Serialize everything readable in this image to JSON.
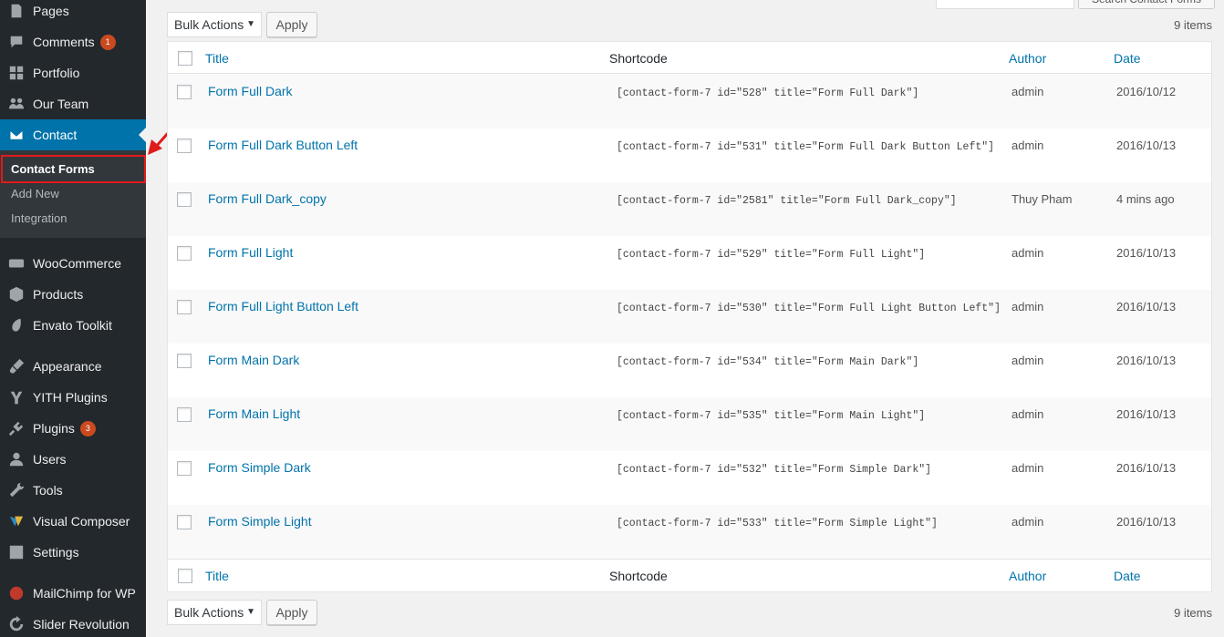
{
  "colors": {
    "sidebar_bg": "#23282d",
    "submenu_bg": "#32373c",
    "accent": "#0073aa",
    "badge": "#ca4a1f",
    "highlight": "#e01b1b"
  },
  "sidebar": {
    "items": [
      {
        "label": "Pages",
        "icon": "pages-icon"
      },
      {
        "label": "Comments",
        "icon": "comments-icon",
        "badge": "1"
      },
      {
        "label": "Portfolio",
        "icon": "portfolio-icon"
      },
      {
        "label": "Our Team",
        "icon": "team-icon"
      },
      {
        "label": "Contact",
        "icon": "mail-icon",
        "current": true
      },
      {
        "label": "WooCommerce",
        "icon": "woocommerce-icon"
      },
      {
        "label": "Products",
        "icon": "products-icon"
      },
      {
        "label": "Envato Toolkit",
        "icon": "envato-icon"
      },
      {
        "label": "Appearance",
        "icon": "appearance-icon"
      },
      {
        "label": "YITH Plugins",
        "icon": "yith-icon"
      },
      {
        "label": "Plugins",
        "icon": "plugins-icon",
        "badge": "3"
      },
      {
        "label": "Users",
        "icon": "users-icon"
      },
      {
        "label": "Tools",
        "icon": "tools-icon"
      },
      {
        "label": "Visual Composer",
        "icon": "visual-composer-icon"
      },
      {
        "label": "Settings",
        "icon": "settings-icon"
      },
      {
        "label": "MailChimp for WP",
        "icon": "mailchimp-icon"
      },
      {
        "label": "Slider Revolution",
        "icon": "slider-revolution-icon"
      }
    ],
    "submenu": [
      {
        "label": "Contact Forms",
        "active": true
      },
      {
        "label": "Add New"
      },
      {
        "label": "Integration"
      }
    ]
  },
  "search": {
    "button_label": "Search Contact Forms"
  },
  "tablenav": {
    "bulk_label": "Bulk Actions",
    "apply_label": "Apply",
    "items_count": "9 items"
  },
  "table": {
    "columns": {
      "title": "Title",
      "shortcode": "Shortcode",
      "author": "Author",
      "date": "Date"
    },
    "rows": [
      {
        "title": "Form Full Dark",
        "shortcode": "[contact-form-7 id=\"528\" title=\"Form Full Dark\"]",
        "author": "admin",
        "date": "2016/10/12"
      },
      {
        "title": "Form Full Dark Button Left",
        "shortcode": "[contact-form-7 id=\"531\" title=\"Form Full Dark Button Left\"]",
        "author": "admin",
        "date": "2016/10/13"
      },
      {
        "title": "Form Full Dark_copy",
        "shortcode": "[contact-form-7 id=\"2581\" title=\"Form Full Dark_copy\"]",
        "author": "Thuy Pham",
        "date": "4 mins ago"
      },
      {
        "title": "Form Full Light",
        "shortcode": "[contact-form-7 id=\"529\" title=\"Form Full Light\"]",
        "author": "admin",
        "date": "2016/10/13"
      },
      {
        "title": "Form Full Light Button Left",
        "shortcode": "[contact-form-7 id=\"530\" title=\"Form Full Light Button Left\"]",
        "author": "admin",
        "date": "2016/10/13"
      },
      {
        "title": "Form Main Dark",
        "shortcode": "[contact-form-7 id=\"534\" title=\"Form Main Dark\"]",
        "author": "admin",
        "date": "2016/10/13"
      },
      {
        "title": "Form Main Light",
        "shortcode": "[contact-form-7 id=\"535\" title=\"Form Main Light\"]",
        "author": "admin",
        "date": "2016/10/13"
      },
      {
        "title": "Form Simple Dark",
        "shortcode": "[contact-form-7 id=\"532\" title=\"Form Simple Dark\"]",
        "author": "admin",
        "date": "2016/10/13"
      },
      {
        "title": "Form Simple Light",
        "shortcode": "[contact-form-7 id=\"533\" title=\"Form Simple Light\"]",
        "author": "admin",
        "date": "2016/10/13"
      }
    ]
  }
}
